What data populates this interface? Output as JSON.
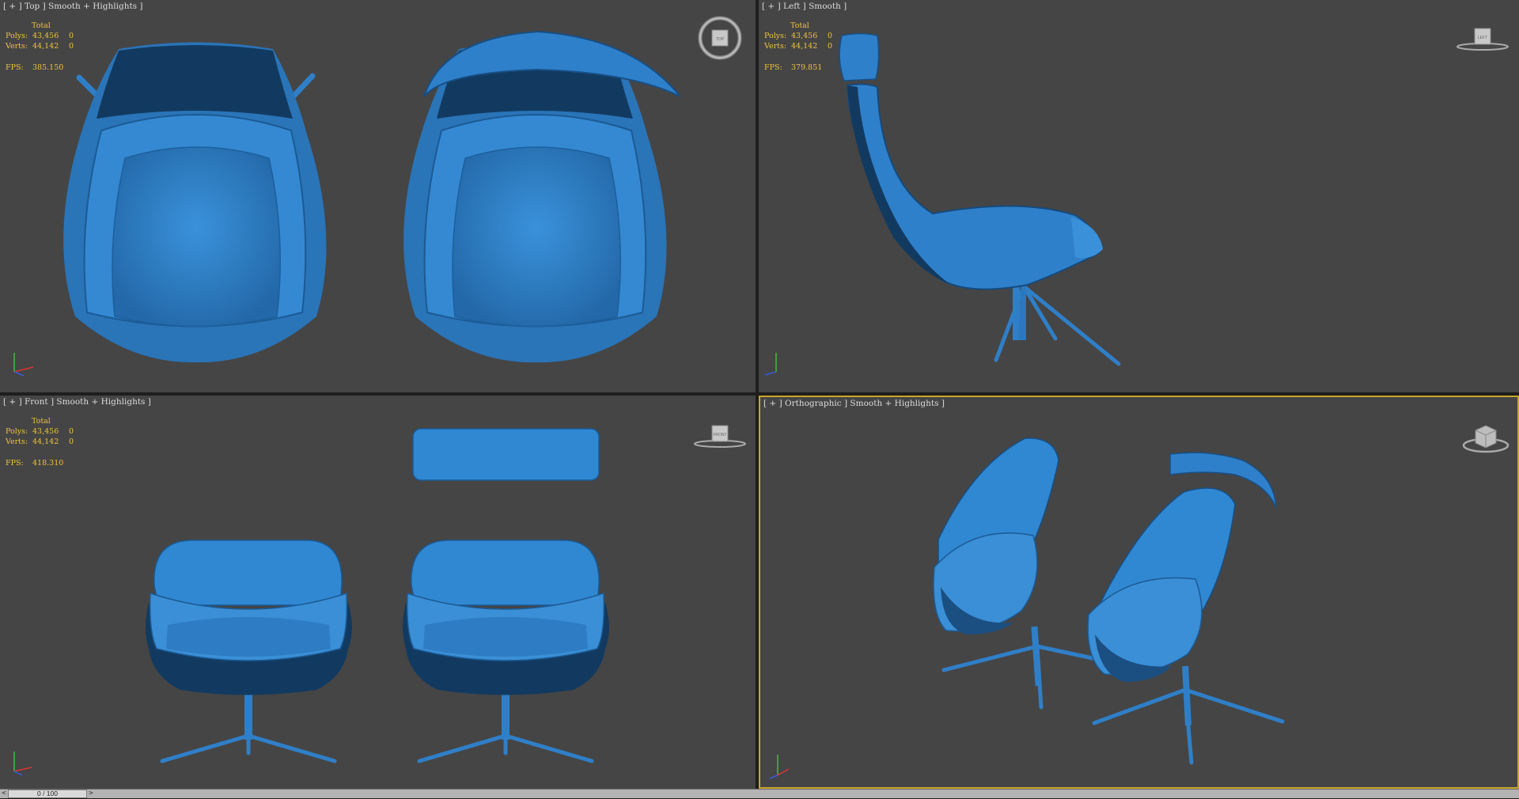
{
  "viewports": {
    "top": {
      "label": "[ + ] Top ] Smooth + Highlights ]",
      "stats": {
        "total": "Total",
        "polys_label": "Polys:",
        "polys": "43,456",
        "polys_sel": "0",
        "verts_label": "Verts:",
        "verts": "44,142",
        "verts_sel": "0",
        "fps_label": "FPS:",
        "fps": "385.150"
      },
      "cube_face": "TOP"
    },
    "left": {
      "label": "[ + ] Left ] Smooth ]",
      "stats": {
        "total": "Total",
        "polys_label": "Polys:",
        "polys": "43,456",
        "polys_sel": "0",
        "verts_label": "Verts:",
        "verts": "44,142",
        "verts_sel": "0",
        "fps_label": "FPS:",
        "fps": "379.851"
      },
      "cube_face": "LEFT"
    },
    "front": {
      "label": "[ + ] Front ] Smooth + Highlights ]",
      "stats": {
        "total": "Total",
        "polys_label": "Polys:",
        "polys": "43,456",
        "polys_sel": "0",
        "verts_label": "Verts:",
        "verts": "44,142",
        "verts_sel": "0",
        "fps_label": "FPS:",
        "fps": "418.310"
      },
      "cube_face": "FRONT"
    },
    "ortho": {
      "label": "[ + ] Orthographic ] Smooth + Highlights ]",
      "cube_face": ""
    }
  },
  "timeline": {
    "prev": "<",
    "frame": "0 / 100",
    "next": ">"
  },
  "colors": {
    "viewport_bg": "#454545",
    "chair_blue": "#2f7fc8",
    "stats_text": "#f0c23c",
    "active_border": "#c9a62a"
  }
}
